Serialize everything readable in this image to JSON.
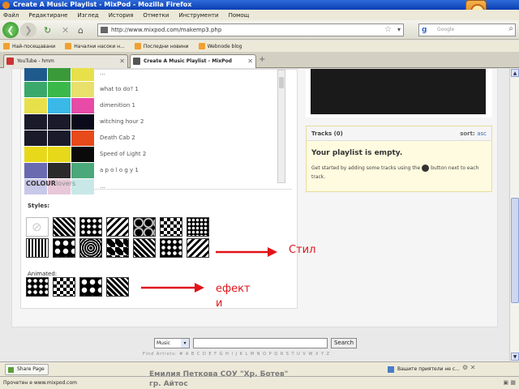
{
  "window": {
    "title": "Create A Music Playlist - MixPod - Mozilla Firefox"
  },
  "menu": [
    "Файл",
    "Редактиране",
    "Изглед",
    "История",
    "Отметки",
    "Инструменти",
    "Помощ"
  ],
  "nav": {
    "url": "http://www.mixpod.com/makemp3.php",
    "search_placeholder": "Google",
    "search_engine_icon": "google-icon"
  },
  "bookmarks": [
    "Най-посещавани",
    "Начални насоки н...",
    "Последни новини",
    "Webnode blog"
  ],
  "tabs": [
    {
      "label": "YouTube - hmm",
      "active": false
    },
    {
      "label": "Create A Music Playlist - MixPod",
      "active": true
    }
  ],
  "palettes": [
    {
      "name": "...",
      "colors": [
        "#1e5a8c",
        "#3a9a3a",
        "#e8e04a"
      ]
    },
    {
      "name": "what to do? 1",
      "colors": [
        "#3aa86a",
        "#3ab84a",
        "#e8e06a"
      ]
    },
    {
      "name": "dimenition 1",
      "colors": [
        "#e8e04a",
        "#3ab8e8",
        "#e84aa8"
      ]
    },
    {
      "name": "witching hour 2",
      "colors": [
        "#1a1a2a",
        "#1a1a2a",
        "#0a0a1a"
      ]
    },
    {
      "name": "Death Cab 2",
      "colors": [
        "#1a1a2a",
        "#1a1a2a",
        "#e84a1a"
      ]
    },
    {
      "name": "Speed of Light 2",
      "colors": [
        "#e8d81a",
        "#e8d81a",
        "#0a0a0a"
      ]
    },
    {
      "name": "a p o l o g y 1",
      "colors": [
        "#6a6ab0",
        "#2a2a2a",
        "#4aa87a"
      ]
    },
    {
      "name": "...",
      "colors": [
        "#c8c8e8",
        "#e8c8d8",
        "#c8e8e8"
      ]
    }
  ],
  "colourlovers": {
    "brand": "COLOUR",
    "suffix": "lovers"
  },
  "styles_label": "Styles:",
  "animated_label": "Animated:",
  "tracks": {
    "header": "Tracks (0)",
    "sort_label": "sort:",
    "sort_value": "asc",
    "empty_title": "Your playlist is empty.",
    "empty_text_before": "Get started by adding some tracks using the",
    "empty_text_after": "button next to each track."
  },
  "search": {
    "select_value": "Music",
    "button": "Search"
  },
  "alpha_row": "Find Artists: # A B C D E F G H I J K L M N O P Q R S T U V W X Y Z",
  "addon": {
    "share": "Share Page",
    "friends": "Вашите приятели не с..."
  },
  "status": "Прочетен е www.mixpod.com",
  "annotations": {
    "stil": "Стил",
    "efekti": "ефекти"
  },
  "caption": "Емилия Петкова СОУ \"Хр. Ботев\" гр. Айтос",
  "accent_colors": {
    "arrow": "#e0141a",
    "player": "#1a1a1a",
    "tracks_bg": "#fffbe0"
  }
}
